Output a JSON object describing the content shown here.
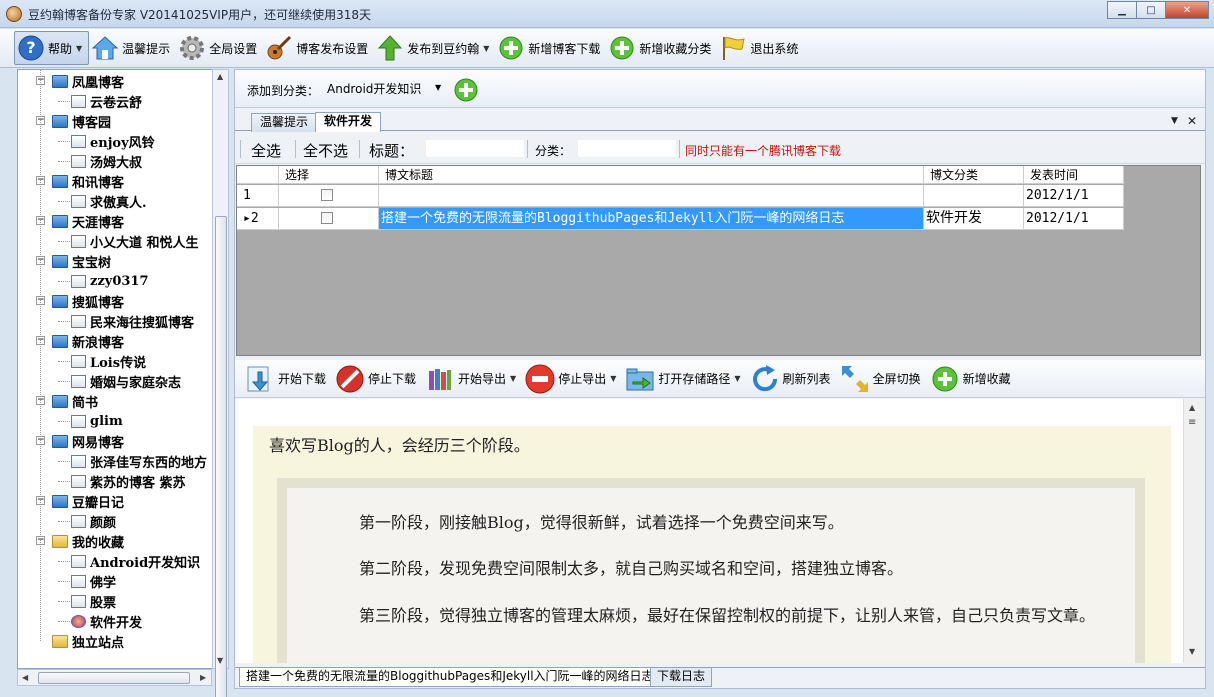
{
  "window": {
    "title": "豆约翰博客备份专家 V20141025VIP用户，还可继续使用318天",
    "minimize": "▁",
    "maximize": "□",
    "close": "✕"
  },
  "toolbar": {
    "help": "帮助",
    "tips": "温馨提示",
    "global_settings": "全局设置",
    "blog_publish_settings": "博客发布设置",
    "publish_to": "发布到豆约翰",
    "new_blog_download": "新增博客下载",
    "new_favorite_category": "新增收藏分类",
    "exit": "退出系统"
  },
  "tree": {
    "nodes": [
      {
        "label": "凤凰博客",
        "kind": "folder"
      },
      {
        "label": "云卷云舒",
        "kind": "leaf"
      },
      {
        "label": "博客园",
        "kind": "folder"
      },
      {
        "label": "enjoy风铃",
        "kind": "leaf"
      },
      {
        "label": "汤姆大叔",
        "kind": "leaf"
      },
      {
        "label": "和讯博客",
        "kind": "folder"
      },
      {
        "label": "求傲真人.",
        "kind": "leaf"
      },
      {
        "label": "天涯博客",
        "kind": "folder"
      },
      {
        "label": "小乂大道  和悦人生",
        "kind": "leaf"
      },
      {
        "label": "宝宝树",
        "kind": "folder"
      },
      {
        "label": "zzy0317",
        "kind": "leaf"
      },
      {
        "label": "搜狐博客",
        "kind": "folder"
      },
      {
        "label": "民来海往搜狐博客",
        "kind": "leaf"
      },
      {
        "label": "新浪博客",
        "kind": "folder"
      },
      {
        "label": "Lois传说",
        "kind": "leaf"
      },
      {
        "label": "婚姻与家庭杂志",
        "kind": "leaf"
      },
      {
        "label": "简书",
        "kind": "folder"
      },
      {
        "label": "glim",
        "kind": "leaf"
      },
      {
        "label": "网易博客",
        "kind": "folder"
      },
      {
        "label": "张泽佳写东西的地方",
        "kind": "leaf"
      },
      {
        "label": "紫苏的博客  紫苏",
        "kind": "leaf"
      },
      {
        "label": "豆瓣日记",
        "kind": "folder"
      },
      {
        "label": "颜颜",
        "kind": "leaf"
      },
      {
        "label": "我的收藏",
        "kind": "folder-open"
      },
      {
        "label": "Android开发知识",
        "kind": "leaf"
      },
      {
        "label": "佛学",
        "kind": "leaf"
      },
      {
        "label": "股票",
        "kind": "leaf"
      },
      {
        "label": "软件开发",
        "kind": "leaf-special"
      },
      {
        "label": "独立站点",
        "kind": "folder-plain"
      }
    ]
  },
  "category_bar": {
    "label": "添加到分类：",
    "selected": "Android开发知识"
  },
  "tabs": {
    "tips": "温馨提示",
    "dev": "软件开发"
  },
  "filter_bar": {
    "select_all": "全选",
    "select_none": "全不选",
    "title_label": "标题：",
    "category_label": "分类：",
    "warning": "同时只能有一个腾讯博客下载"
  },
  "grid": {
    "headers": [
      "选择",
      "博文标题",
      "博文分类",
      "发表时间"
    ],
    "rows": [
      {
        "num": "1",
        "title": "",
        "category": "",
        "date": "2012/1/1",
        "marker": ""
      },
      {
        "num": "2",
        "title": "搭建一个免费的无限流量的BloggithubPages和Jekyll入门阮一峰的网络日志",
        "category": "软件开发",
        "date": "2012/1/1",
        "marker": "▸"
      }
    ]
  },
  "actions": {
    "start_download": "开始下载",
    "stop_download": "停止下载",
    "start_export": "开始导出",
    "stop_export": "停止导出",
    "open_path": "打开存储路径",
    "refresh": "刷新列表",
    "fullscreen": "全屏切换",
    "add_favorite": "新增收藏"
  },
  "preview": {
    "intro": "喜欢写Blog的人，会经历三个阶段。",
    "paragraphs": [
      "第一阶段，刚接触Blog，觉得很新鲜，试着选择一个免费空间来写。",
      "第二阶段，发现免费空间限制太多，就自己购买域名和空间，搭建独立博客。",
      "第三阶段，觉得独立博客的管理太麻烦，最好在保留控制权的前提下，让别人来管，自己只负责写文章。"
    ]
  },
  "status_tabs": {
    "article": "搭建一个免费的无限流量的BloggithubPages和Jekyll入门阮一峰的网络日志",
    "log": "下载日志"
  }
}
